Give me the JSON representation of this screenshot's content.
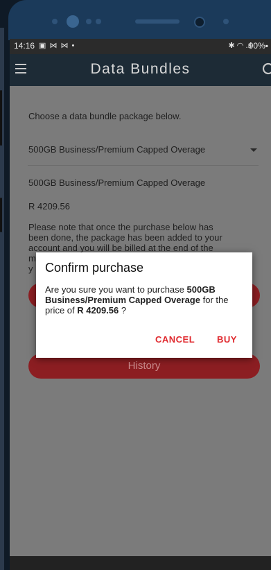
{
  "status_bar": {
    "time": "14:16",
    "sys_icons": "▣ ⋈ ⋈ •",
    "right_icons": "✱ ◠ .ıl",
    "battery": "90%▪"
  },
  "app_bar": {
    "title": "Data Bundles"
  },
  "content": {
    "intro": "Choose a data bundle package below.",
    "selected_package": "500GB Business/Premium Capped Overage",
    "package_name": "500GB Business/Premium Capped Overage",
    "package_price": "R 4209.56",
    "note_lines": [
      "Please note that once the purchase below has",
      "been done, the package has been added to your",
      "account and you will be billed at the end of the",
      "m",
      "y"
    ],
    "history_label": "History"
  },
  "dialog": {
    "title": "Confirm purchase",
    "msg_prefix": "Are you sure you want to purchase ",
    "msg_package": "500GB Business/Premium Capped Overage",
    "msg_mid": " for the price of ",
    "msg_price": "R 4209.56",
    "msg_suffix": " ?",
    "cancel_label": "CANCEL",
    "buy_label": "BUY"
  },
  "colors": {
    "accent": "#e0292e",
    "appbar": "#1d2b36",
    "button": "#8c1e22",
    "overlay": "#7b7b7b"
  }
}
